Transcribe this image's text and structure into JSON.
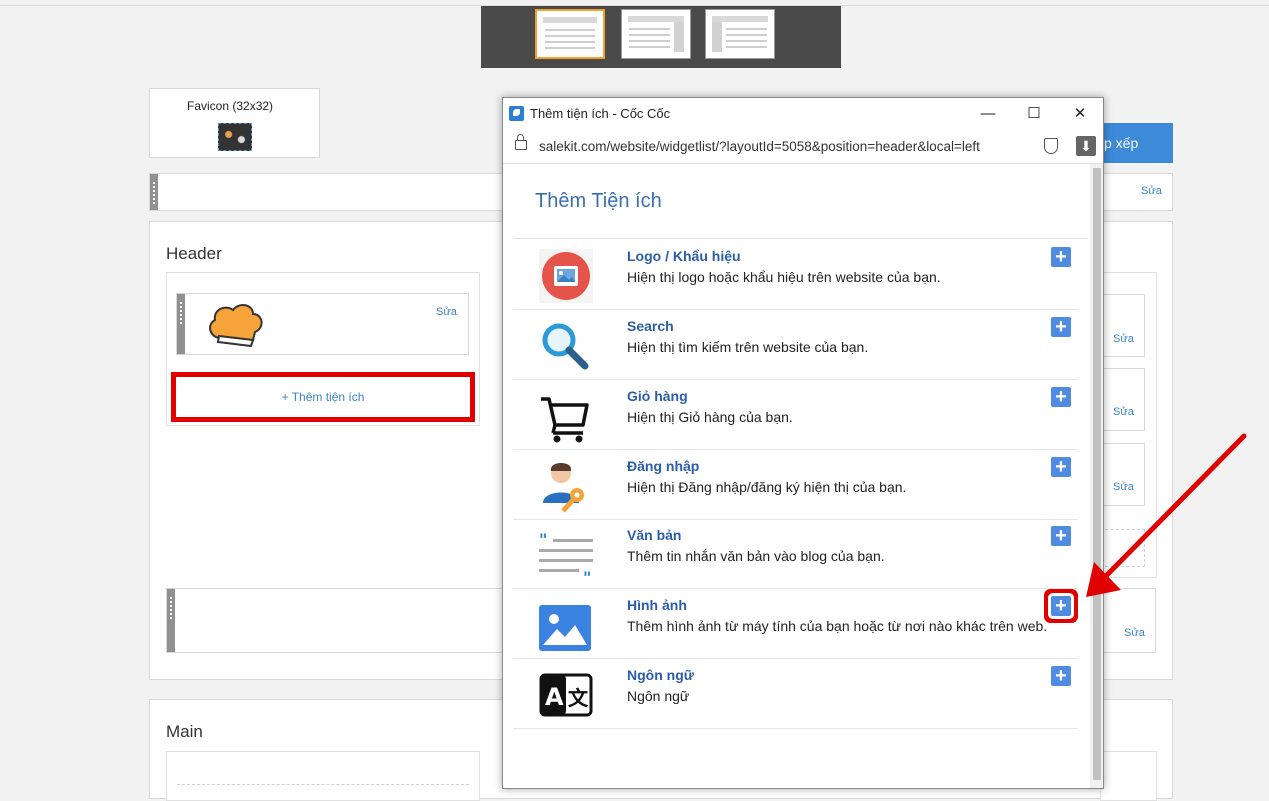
{
  "background": {
    "favicon_title": "Favicon (32x32)",
    "sort_button_label": "p xếp",
    "edit_label": "Sửa",
    "header_title": "Header",
    "main_title": "Main",
    "add_widget_label": "+ Thêm tiện ích"
  },
  "popup": {
    "window_title": "Thêm tiện ích - Cốc Cốc",
    "minimize": "—",
    "maximize": "☐",
    "close": "✕",
    "url": "salekit.com/website/widgetlist/?layoutId=5058&position=header&local=left",
    "download_icon": "⬇",
    "heading": "Thêm Tiện ích",
    "add_symbol": "+",
    "widgets": [
      {
        "name": "Logo / Khẩu hiệu",
        "desc": "Hiện thị logo hoặc khẩu hiệu trên website của bạn.",
        "icon": "logo-icon"
      },
      {
        "name": "Search",
        "desc": "Hiện thị tìm kiếm trên website của bạn.",
        "icon": "search-icon"
      },
      {
        "name": "Giỏ hàng",
        "desc": "Hiện thị Giỏ hàng của bạn.",
        "icon": "cart-icon"
      },
      {
        "name": "Đăng nhập",
        "desc": "Hiện thị Đăng nhập/đăng ký hiện thị của bạn.",
        "icon": "login-icon"
      },
      {
        "name": "Văn bản",
        "desc": "Thêm tin nhắn văn bản vào blog của bạn.",
        "icon": "text-icon"
      },
      {
        "name": "Hình ảnh",
        "desc": "Thêm hình ảnh từ máy tính của bạn hoặc từ nơi nào khác trên web.",
        "icon": "image-icon"
      },
      {
        "name": "Ngôn ngữ",
        "desc": "Ngôn ngữ",
        "icon": "language-icon"
      }
    ]
  },
  "colors": {
    "accent": "#3a84c9",
    "highlight": "#e00000",
    "add_button": "#4f8be0"
  }
}
